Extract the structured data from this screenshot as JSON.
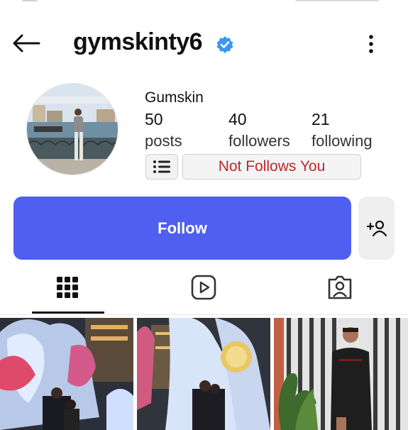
{
  "profile": {
    "username": "gymskinty6",
    "display_name": "Gumskin",
    "stats": {
      "posts": {
        "count": "50",
        "label": "posts"
      },
      "followers": {
        "count": "40",
        "label": "followers"
      },
      "following": {
        "count": "21",
        "label": "following"
      }
    },
    "relationship_badge": "Not Follows You",
    "verified": true
  },
  "actions": {
    "follow_label": "Follow"
  },
  "icons": {
    "back": "arrow-left-icon",
    "verified": "verified-badge-icon",
    "more": "more-vertical-icon",
    "list": "list-icon",
    "suggest": "add-user-icon",
    "grid": "grid-icon",
    "reels": "reels-icon",
    "tagged": "tagged-icon"
  },
  "colors": {
    "accent": "#4f5ff0",
    "verified": "#3897f0",
    "badge_text": "#c0272d"
  },
  "tabs": [
    {
      "id": "grid",
      "active": true
    },
    {
      "id": "reels",
      "active": false
    },
    {
      "id": "tagged",
      "active": false
    }
  ]
}
